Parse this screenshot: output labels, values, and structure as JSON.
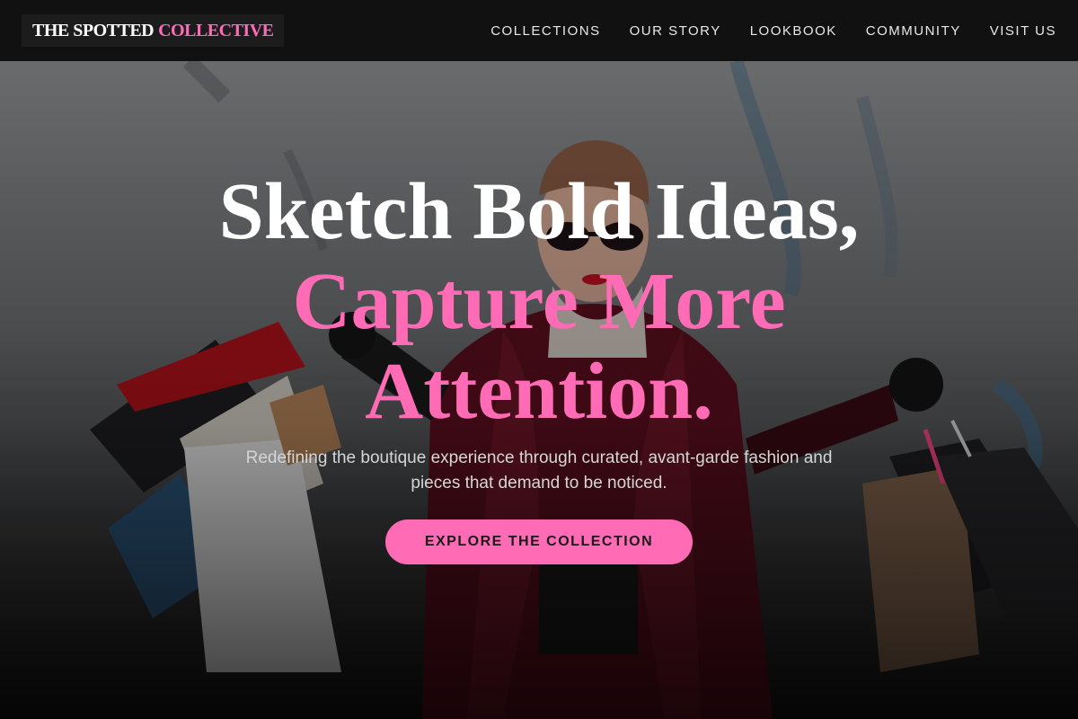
{
  "brand": {
    "part1": "THE SPOTTED",
    "part2": "COLLECTIVE",
    "accent_color": "#ff6bb5"
  },
  "nav": {
    "items": [
      {
        "label": "COLLECTIONS"
      },
      {
        "label": "OUR STORY"
      },
      {
        "label": "LOOKBOOK"
      },
      {
        "label": "COMMUNITY"
      },
      {
        "label": "VISIT US"
      }
    ]
  },
  "hero": {
    "headline_line1": "Sketch Bold Ideas,",
    "headline_line2": "Capture More",
    "headline_line3": "Attention.",
    "subtext": "Redefining the boutique experience through curated, avant-garde fashion and pieces that demand to be noticed.",
    "cta_label": "EXPLORE THE COLLECTION"
  }
}
